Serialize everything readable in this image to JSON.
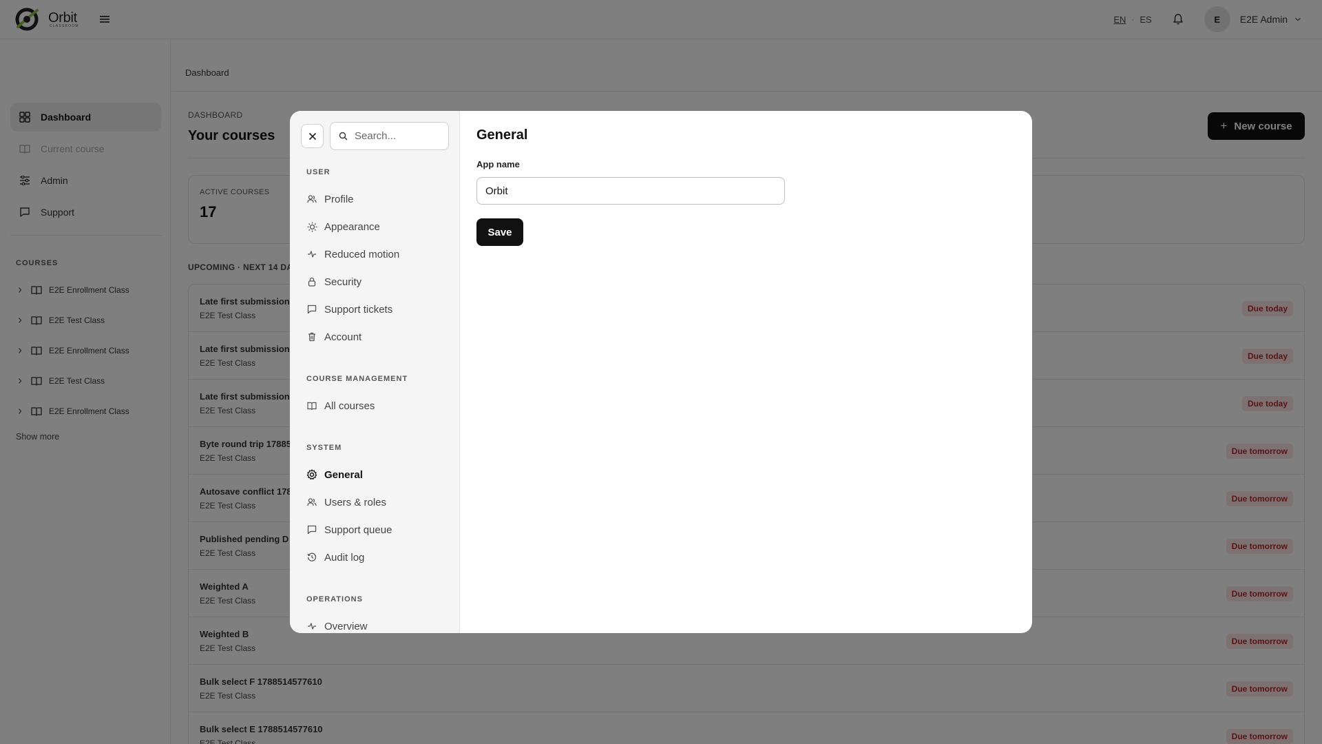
{
  "header": {
    "logo_name": "Orbit",
    "logo_sub": "CLASSROOM",
    "lang_en": "EN",
    "lang_sep": "·",
    "lang_es": "ES",
    "avatar_initial": "E",
    "user_name": "E2E Admin"
  },
  "sidebar": {
    "nav": [
      {
        "label": "Dashboard",
        "icon": "dashboard-icon"
      },
      {
        "label": "Current course",
        "icon": "book-icon"
      },
      {
        "label": "Admin",
        "icon": "sliders-icon"
      },
      {
        "label": "Support",
        "icon": "chat-icon"
      }
    ],
    "courses_heading": "COURSES",
    "courses": [
      "E2E Enrollment Class",
      "E2E Test Class",
      "E2E Enrollment Class",
      "E2E Test Class",
      "E2E Enrollment Class"
    ],
    "show_more": "Show more"
  },
  "main": {
    "breadcrumb": "Dashboard",
    "eyebrow": "DASHBOARD",
    "title": "Your courses",
    "new_course_label": "New course",
    "stat_label": "ACTIVE COURSES",
    "stat_value": "17",
    "upcoming_heading": "UPCOMING · NEXT 14 DA",
    "rows": [
      {
        "title": "Late first submission",
        "course": "E2E Test Class",
        "due": "Due today"
      },
      {
        "title": "Late first submission",
        "course": "E2E Test Class",
        "due": "Due today"
      },
      {
        "title": "Late first submission",
        "course": "E2E Test Class",
        "due": "Due today"
      },
      {
        "title": "Byte round trip 17885",
        "course": "E2E Test Class",
        "due": "Due tomorrow"
      },
      {
        "title": "Autosave conflict 178",
        "course": "E2E Test Class",
        "due": "Due tomorrow"
      },
      {
        "title": "Published pending D",
        "course": "E2E Test Class",
        "due": "Due tomorrow"
      },
      {
        "title": "Weighted A",
        "course": "E2E Test Class",
        "due": "Due tomorrow"
      },
      {
        "title": "Weighted B",
        "course": "E2E Test Class",
        "due": "Due tomorrow"
      },
      {
        "title": "Bulk select F 1788514577610",
        "course": "E2E Test Class",
        "due": "Due tomorrow"
      },
      {
        "title": "Bulk select E 1788514577610",
        "course": "E2E Test Class",
        "due": "Due tomorrow"
      }
    ]
  },
  "modal": {
    "search_placeholder": "Search...",
    "sections": {
      "user": "USER",
      "course_management": "COURSE MANAGEMENT",
      "system": "SYSTEM",
      "operations": "OPERATIONS"
    },
    "items": {
      "profile": "Profile",
      "appearance": "Appearance",
      "reduced_motion": "Reduced motion",
      "security": "Security",
      "support_tickets": "Support tickets",
      "account": "Account",
      "all_courses": "All courses",
      "general": "General",
      "users_roles": "Users & roles",
      "support_queue": "Support queue",
      "audit_log": "Audit log",
      "overview": "Overview"
    },
    "panel": {
      "title": "General",
      "app_name_label": "App name",
      "app_name_value": "Orbit",
      "save_label": "Save"
    }
  },
  "colors": {
    "accent": "#111111",
    "due_bg": "#fbe3e3",
    "due_text": "#b22a2a",
    "overlay": "rgba(0,0,0,0.5)"
  }
}
